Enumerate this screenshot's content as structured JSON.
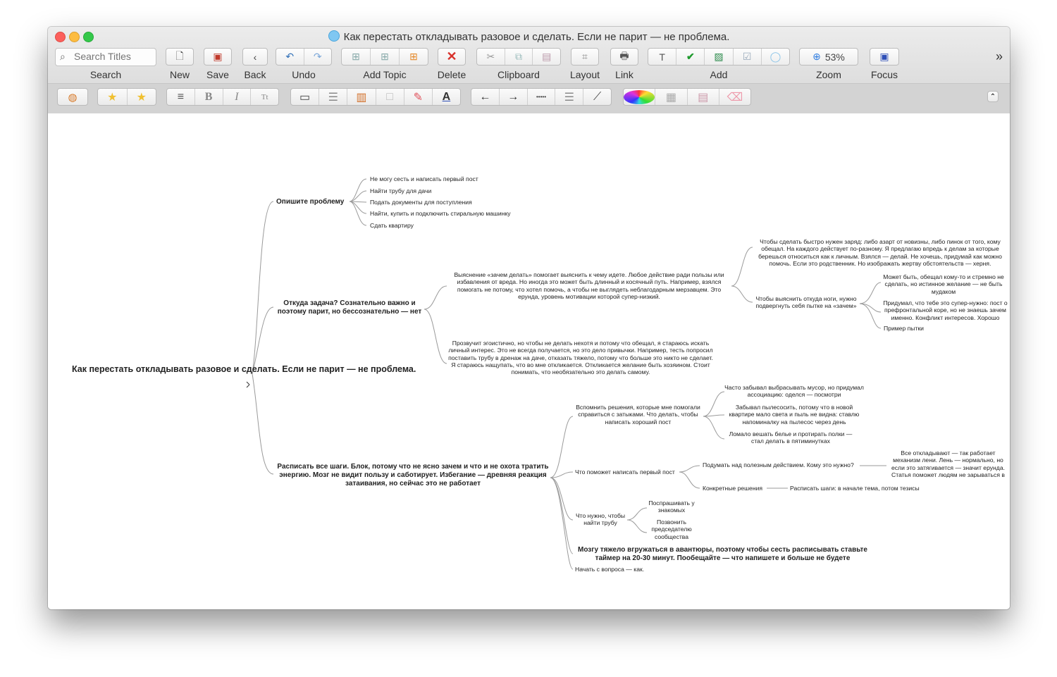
{
  "window": {
    "title": "Как перестать откладывать разовое и сделать. Если не парит — не проблема."
  },
  "toolbar": {
    "search_placeholder": "Search Titles",
    "search_label": "Search",
    "new_label": "New",
    "save_label": "Save",
    "back_label": "Back",
    "undo_label": "Undo",
    "add_topic_label": "Add Topic",
    "delete_label": "Delete",
    "clipboard_label": "Clipboard",
    "layout_label": "Layout",
    "link_label": "Link",
    "add_label": "Add",
    "zoom_label": "Zoom",
    "zoom_value": "53%",
    "focus_label": "Focus",
    "overflow": "»"
  },
  "format_bar": {
    "bold": "B",
    "italic": "I",
    "text": "Tt",
    "text_color": "A",
    "arrow_left": "←",
    "arrow_right": "→",
    "dots": "•••••"
  },
  "map": {
    "root": "Как перестать откладывать разовое и сделать. Если не парит — не проблема.",
    "b1": {
      "title": "Опишите проблему",
      "items": [
        "Не могу сесть и написать первый пост",
        "Найти трубу для дачи",
        "Подать документы для поступления",
        "Найти, купить и подключить стиральную машинку",
        "Сдать квартиру"
      ]
    },
    "b2": {
      "title": "Откуда задача? Сознательно важно и поэтому парит, но бессознательно — нет",
      "why": "Выяснение «зачем делать» помогает выяснить к чему идете. Любое действие ради пользы или избавления от вреда. Но иногда это может быть длинный и косячный путь. Например, взялся помогать не потому, что хотел помочь, а чтобы не выглядеть неблагодарным мерзавцем. Это ерунда, уровень мотивации которой супер-низкий.",
      "charge": "Чтобы сделать быстро нужен заряд: либо азарт от новизны, либо пинок от того, кому обещал. На каждого действует по-разному. Я предлагаю впредь к делам за которые берешься относиться как к личным. Взялся — делай. Не хочешь, придумай как можно помочь. Если это родственник. Но изображать жертву обстоятельств — херня.",
      "legs": "Чтобы выяснить откуда ноги, нужно подвергнуть себя пытке на «зачем»",
      "leg1": "Может быть, обещал кому-то и стремно не сделать, но истинное желание — не быть мудаком",
      "leg2": "Придумал, что тебе это супер-нужно: пост о префронтальной коре, но не знаешь зачем именно. Конфликт интересов. Хорошо",
      "leg3": "Пример пытки",
      "selfish": "Прозвучит эгоистично, но чтобы не делать нехотя и потому что обещал, я стараюсь искать личный интерес. Это не всегда получается, но это дело привычки. Например, тесть попросил поставить трубу в дренаж на даче, отказать тяжело, потому что больше это никто не сделает. Я стараюсь нащупать, что во мне откликается. Откликается желание быть хозяином. Стоит понимать, что необязательно это делать самому."
    },
    "b3": {
      "title": "Расписать все шаги. Блок, потому что не ясно зачем и что и не охота тратить энергию. Мозг не видит пользу и саботирует. Избегание — древняя реакция затаивания, но сейчас это не работает",
      "recall": "Вспомнить решения, которые мне помогали справиться с затыками. Что делать, чтобы написать хороший пост",
      "r1": "Часто забывал выбрасывать мусор, но придумал ассоциацию: оделся — посмотри",
      "r2": "Забывал пылесосить, потому что в новой квартире мало света и пыль не видна: ставлю напоминалку на пылесос через день",
      "r3": "Ломало вешать белье и протирать полки — стал делать в пятиминутках",
      "help": "Что поможет написать первый пост",
      "think": "Подумать над полезным действием. Кому это нужно?",
      "everyone": "Все откладывают — так работает механизм лени. Лень — нормально, но если это затягивается — значит ерунда. Статья поможет людям не зарываться в старое говно",
      "concrete": "Конкретные решения",
      "steps": "Расписать шаги: в начале тема, потом тезисы",
      "pipe": "Что нужно, чтобы найти трубу",
      "ask": "Поспрашивать у знакомых",
      "call": "Позвонить председателю сообщества",
      "brain": "Мозгу тяжело вгружаться в авантюры, поэтому чтобы сесть расписывать ставьте таймер на 20-30 минут. Пообещайте — что напишете и больше не будете",
      "start": "Начать с вопроса — как."
    }
  },
  "colors": {
    "line": "#9a9a9a",
    "accent": "#2f7de1"
  }
}
